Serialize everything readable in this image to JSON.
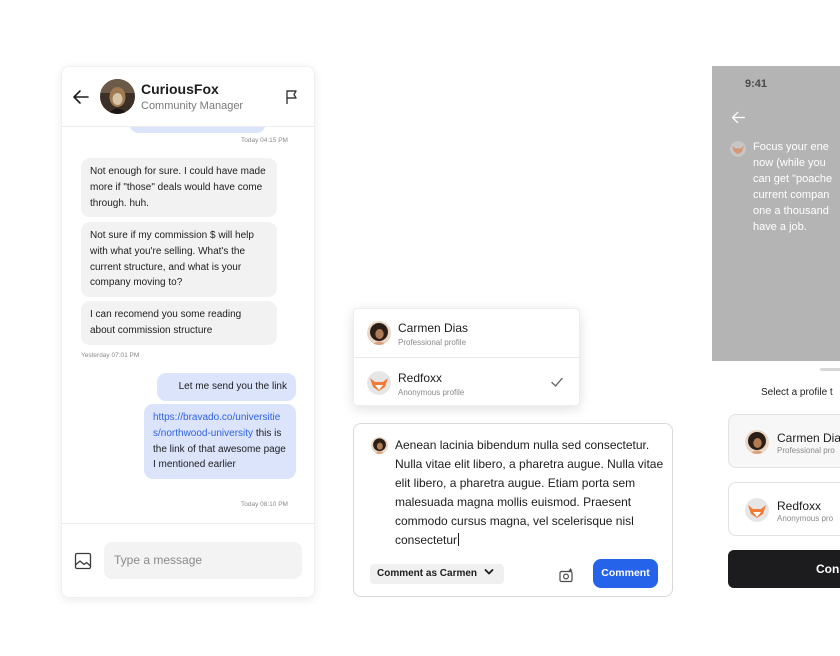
{
  "chat": {
    "name": "CuriousFox",
    "role": "Community Manager",
    "messages": [
      {
        "dir": "in",
        "text": "Not enough for sure. I could have made more if \"those\" deals would have come through. huh."
      },
      {
        "dir": "in",
        "text": "Not sure if my commission $ will help with what you're selling. What's the current structure, and what is your company moving to?"
      },
      {
        "dir": "in",
        "text": "I can recomend you some reading about commission structure"
      },
      {
        "dir": "out",
        "text": "Let me send you the link"
      },
      {
        "dir": "out",
        "link": "https://bravado.co/universities/northwood-university",
        "text": " this is the link of that awesome page I mentioned earlier"
      }
    ],
    "timestamps": [
      "Today 04:15 PM",
      "Yesterday 07:01 PM",
      "Today 08:10 PM"
    ],
    "input_placeholder": "Type a message",
    "icons": [
      "back-arrow-icon",
      "flag-icon",
      "image-icon"
    ]
  },
  "dropdown": {
    "items": [
      {
        "name": "Carmen Dias",
        "sub": "Professional profile",
        "selected": false
      },
      {
        "name": "Redfoxx",
        "sub": "Anonymous profile",
        "selected": true
      }
    ]
  },
  "comment": {
    "text": "Aenean lacinia bibendum nulla sed consectetur. Nulla vitae elit libero, a pharetra augue. Nulla vitae elit libero, a pharetra augue. Etiam porta sem malesuada magna mollis euismod. Praesent commodo cursus magna, vel scelerisque nisl consectetur",
    "as_label": "Comment as Carmen",
    "button": "Comment",
    "accent": "#2563eb"
  },
  "mobile": {
    "time": "9:41",
    "post_lines": [
      "Focus your ene",
      "now (while you",
      "can get \"poache",
      "current compan",
      "one a thousand",
      "have a job."
    ],
    "select_label": "Select a profile t",
    "cards": [
      {
        "name": "Carmen Dia",
        "sub": "Professional pro"
      },
      {
        "name": "Redfoxx",
        "sub": "Anonymous pro"
      }
    ],
    "cta": "Con"
  }
}
